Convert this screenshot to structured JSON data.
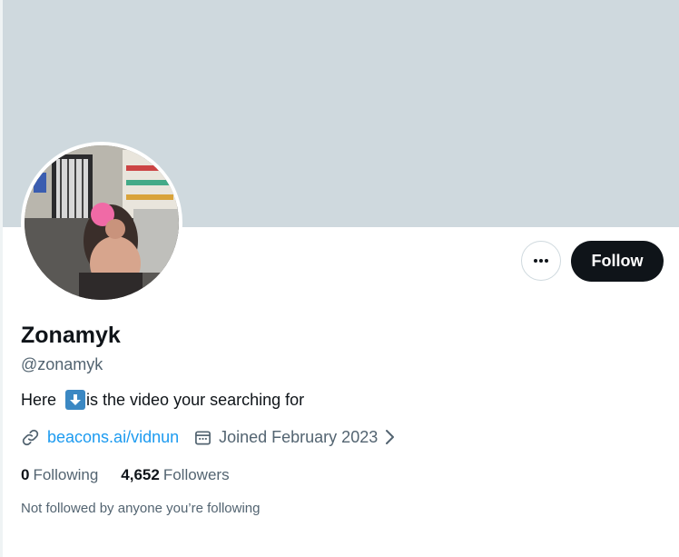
{
  "profile": {
    "display_name": "Zonamyk",
    "handle": "@zonamyk",
    "bio_before_emoji": "Here ",
    "bio_emoji": "⬇",
    "bio_after_emoji": "is the video your searching for",
    "link": "beacons.ai/vidnun",
    "joined": "Joined February 2023"
  },
  "actions": {
    "follow_label": "Follow"
  },
  "stats": {
    "following_count": "0",
    "following_label": "Following",
    "followers_count": "4,652",
    "followers_label": "Followers"
  },
  "social_context": "Not followed by anyone you’re following",
  "colors": {
    "banner": "#cfd9de",
    "accent_link": "#1d9bf0",
    "primary_text": "#0f1419",
    "secondary_text": "#536471",
    "follow_button_bg": "#0f1419"
  },
  "icons": {
    "more": "more-horizontal-icon",
    "link": "link-icon",
    "calendar": "calendar-icon",
    "chevron": "chevron-right-icon"
  }
}
